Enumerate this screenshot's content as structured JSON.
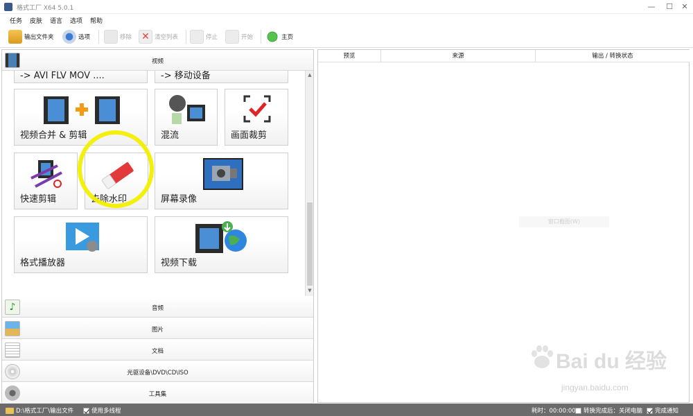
{
  "window": {
    "title": "格式工厂 X64 5.0.1",
    "minimize_glyph": "—",
    "maximize_glyph": "☐",
    "close_glyph": "✕"
  },
  "menu": [
    "任务",
    "皮肤",
    "语言",
    "选项",
    "帮助"
  ],
  "toolbar": {
    "output_folder": "输出文件夹",
    "options": "选项",
    "remove": "移除",
    "clear_list": "清空列表",
    "stop": "停止",
    "start": "开始",
    "home": "主页"
  },
  "left": {
    "video_category": "视频",
    "top_row_partial": [
      "-> AVI FLV MOV ....",
      "-> 移动设备"
    ],
    "tiles": {
      "merge": "视频合并 & 剪辑",
      "mux": "混流",
      "crop": "画面裁剪",
      "quick_clip": "快速剪辑",
      "remove_watermark": "去除水印",
      "screen_record": "屏幕录像",
      "player": "格式播放器",
      "download": "视频下载"
    },
    "categories": [
      "音频",
      "图片",
      "文档",
      "光驱设备\\DVD\\CD\\ISO",
      "工具集"
    ]
  },
  "right": {
    "columns": [
      "预览",
      "来源",
      "输出 / 转换状态"
    ],
    "ghost_button": "窗口截图(W)"
  },
  "status": {
    "output_path": "D:\\格式工厂\\输出文件",
    "multithread": "使用多线程",
    "elapsed": "耗时：00:00:00",
    "after_done": "转换完成后：关闭电脑",
    "notify": "完成通知",
    "multithread_checked": true,
    "after_done_checked": false,
    "notify_checked": true
  },
  "watermark": {
    "main": "Bai du 经验",
    "sub": "jingyan.baidu.com"
  },
  "colors": {
    "highlight": "#f2ef00",
    "statusbar": "#6b6b6b"
  }
}
